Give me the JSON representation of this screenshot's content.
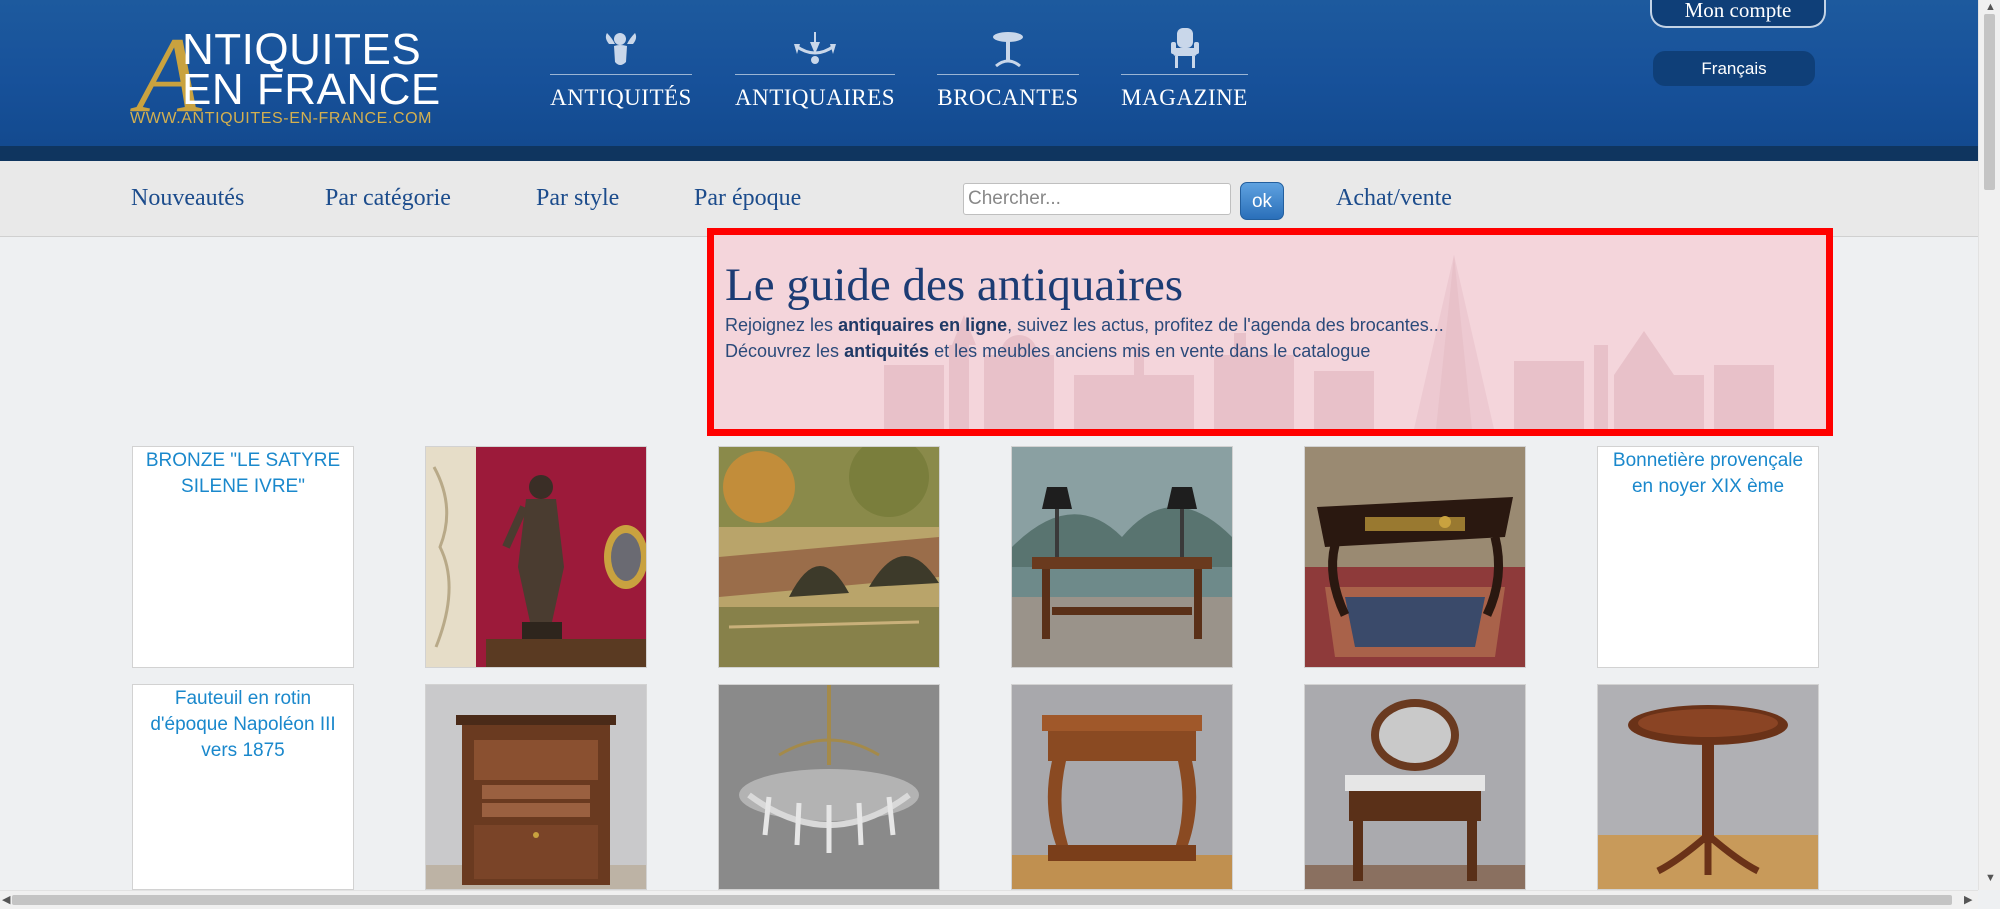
{
  "header": {
    "logo": {
      "line1": "NTIQUITES",
      "line2": "EN FRANCE",
      "url": "WWW.ANTIQUITES-EN-FRANCE.COM"
    },
    "nav": [
      {
        "label": "ANTIQUITÉS",
        "icon": "cherub-icon"
      },
      {
        "label": "ANTIQUAIRES",
        "icon": "chandelier-icon"
      },
      {
        "label": "BROCANTES",
        "icon": "pedestal-table-icon"
      },
      {
        "label": "MAGAZINE",
        "icon": "armchair-icon"
      }
    ],
    "account": "Mon compte",
    "language": "Français"
  },
  "subnav": {
    "links": [
      "Nouveautés",
      "Par catégorie",
      "Par style",
      "Par époque"
    ],
    "search_placeholder": "Chercher...",
    "search_button": "ok",
    "achat": "Achat/vente"
  },
  "intro": {
    "title": "Le guide des antiquaires",
    "line1": {
      "pre": "Rejoignez les ",
      "bold": "antiquaires en ligne",
      "post": ", suivez les actus, profitez de l'agenda des brocantes..."
    },
    "line2": {
      "pre": "Découvrez les ",
      "bold": "antiquités",
      "post": " et les meubles anciens mis en vente dans le catalogue"
    }
  },
  "products": [
    {
      "alt": "BRONZE \"LE SATYRE SILENE IVRE\""
    },
    {
      "image": "bronze-statue"
    },
    {
      "image": "bridge-painting"
    },
    {
      "image": "table-with-lamps"
    },
    {
      "image": "louis-xv-desk"
    },
    {
      "alt": "Bonnetière provençale en noyer XIX ème"
    },
    {
      "alt": "Fauteuil en rotin d'époque Napoléon III vers 1875"
    },
    {
      "image": "secretary-cabinet"
    },
    {
      "image": "crystal-chandelier"
    },
    {
      "image": "console-table"
    },
    {
      "image": "dressing-table"
    },
    {
      "image": "pedestal-table"
    }
  ],
  "colors": {
    "header_blue": "#17519a",
    "gold": "#c9a23f",
    "link_blue": "#1c4c8c",
    "highlight_red": "#ff0000"
  }
}
